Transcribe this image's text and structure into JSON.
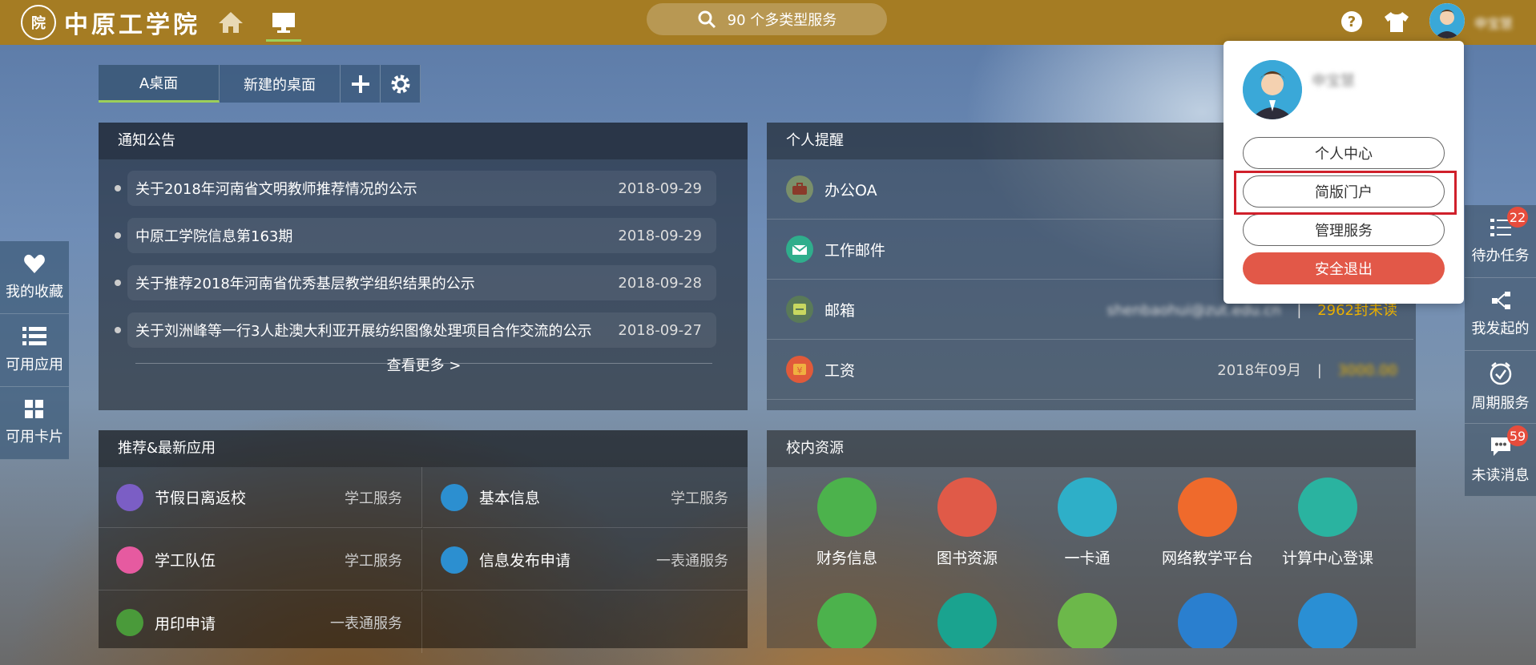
{
  "header": {
    "logo_seal": "院",
    "logo_text": "中原工学院",
    "search_text": "90 个多类型服务",
    "user_name": "申宝慧"
  },
  "tabs": [
    "A桌面",
    "新建的桌面"
  ],
  "notices": {
    "title": "通知公告",
    "items": [
      {
        "text": "关于2018年河南省文明教师推荐情况的公示",
        "date": "2018-09-29"
      },
      {
        "text": "中原工学院信息第163期",
        "date": "2018-09-29"
      },
      {
        "text": "关于推荐2018年河南省优秀基层教学组织结果的公示",
        "date": "2018-09-28"
      },
      {
        "text": "关于刘洲峰等一行3人赴澳大利亚开展纺织图像处理项目合作交流的公示",
        "date": "2018-09-27"
      }
    ],
    "more": "查看更多 >"
  },
  "reminders": {
    "title": "个人提醒",
    "items": [
      {
        "label": "办公OA",
        "left": "",
        "right": "",
        "icon_color": "#7a8f6a"
      },
      {
        "label": "工作邮件",
        "left": "",
        "right": "",
        "icon_color": "#2fae8c"
      },
      {
        "label": "邮箱",
        "left": "shenbaohui@zut.edu.cn",
        "sep": "|",
        "right": "2962封未读",
        "icon_color": "#5a7a58"
      },
      {
        "label": "工资",
        "left": "2018年09月",
        "sep": "|",
        "right": "3000.00",
        "icon_color": "#e05a3a"
      }
    ]
  },
  "apps": {
    "title": "推荐&最新应用",
    "items": [
      {
        "name": "节假日离返校",
        "cat": "学工服务",
        "color": "#7b5ec5"
      },
      {
        "name": "基本信息",
        "cat": "学工服务",
        "color": "#2c8fd0"
      },
      {
        "name": "学工队伍",
        "cat": "学工服务",
        "color": "#e65aa0"
      },
      {
        "name": "信息发布申请",
        "cat": "一表通服务",
        "color": "#2c8fd0"
      },
      {
        "name": "用印申请",
        "cat": "一表通服务",
        "color": "#4a9a3a"
      }
    ]
  },
  "resources": {
    "title": "校内资源",
    "row1": [
      {
        "name": "财务信息",
        "color": "#4cb24c"
      },
      {
        "name": "图书资源",
        "color": "#e05a48"
      },
      {
        "name": "一卡通",
        "color": "#2eafc8"
      },
      {
        "name": "网络教学平台",
        "color": "#ef6a2c"
      },
      {
        "name": "计算中心登课",
        "color": "#2ab3a0"
      }
    ],
    "row2": [
      {
        "color": "#4cb24c"
      },
      {
        "color": "#1aa38f"
      },
      {
        "color": "#6cb84a"
      },
      {
        "color": "#2a7fcf"
      },
      {
        "color": "#2a8fd4"
      }
    ]
  },
  "left_sidebar": [
    {
      "label": "我的收藏",
      "icon": "heart-icon"
    },
    {
      "label": "可用应用",
      "icon": "list-icon"
    },
    {
      "label": "可用卡片",
      "icon": "grid-icon"
    }
  ],
  "right_sidebar": [
    {
      "label": "待办任务",
      "badge": "22",
      "icon": "task-list-icon"
    },
    {
      "label": "我发起的",
      "badge": "",
      "icon": "share-icon"
    },
    {
      "label": "周期服务",
      "badge": "",
      "icon": "clock-check-icon"
    },
    {
      "label": "未读消息",
      "badge": "59",
      "icon": "chat-icon"
    }
  ],
  "popup": {
    "name": "申宝慧",
    "buttons": [
      "个人中心",
      "简版门户",
      "管理服务",
      "安全退出"
    ]
  },
  "colors": {
    "topbar": "#a57c23",
    "accent_green": "#9ccf5a",
    "danger": "#e25848",
    "highlight": "#d0202b",
    "warning_text": "#f0b400"
  }
}
